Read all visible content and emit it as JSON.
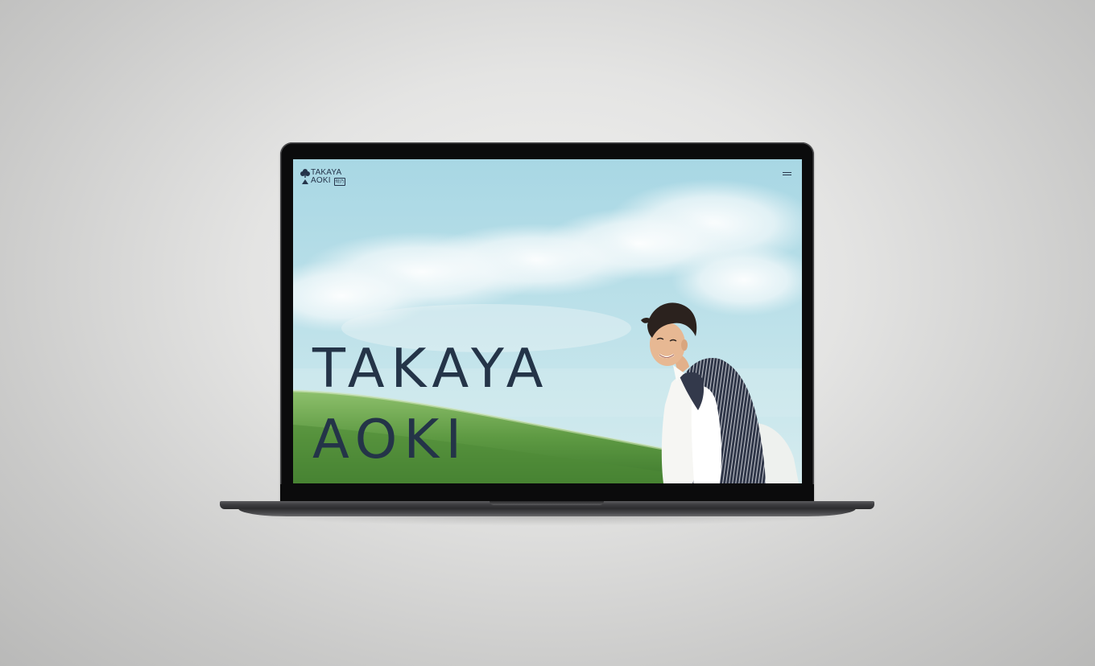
{
  "site": {
    "logo_line1": "TAKAYA",
    "logo_line2": "AOKI",
    "logo_badge": "旬|乃",
    "hero_line1": "TAKAYA",
    "hero_line2": "AOKI"
  },
  "icons": {
    "logo": "tree-logo-icon",
    "menu": "hamburger-menu-icon"
  },
  "colors": {
    "text": "#243448",
    "sky": "#a9d6e3",
    "grass": "#6aa84f"
  }
}
